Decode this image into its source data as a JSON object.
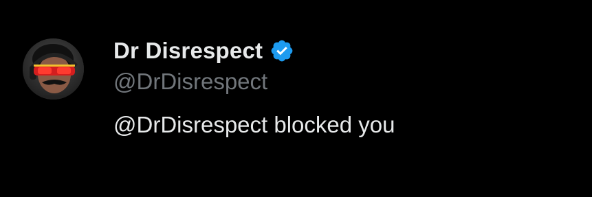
{
  "profile": {
    "display_name": "Dr Disrespect",
    "handle": "@DrDisrespect",
    "verified_icon": "verified-badge-icon",
    "avatar_icon": "avatar-image"
  },
  "message": {
    "text": "@DrDisrespect blocked you"
  },
  "colors": {
    "background": "#000000",
    "primary_text": "#e7e9ea",
    "secondary_text": "#71767b",
    "verified_blue": "#1d9bf0"
  }
}
